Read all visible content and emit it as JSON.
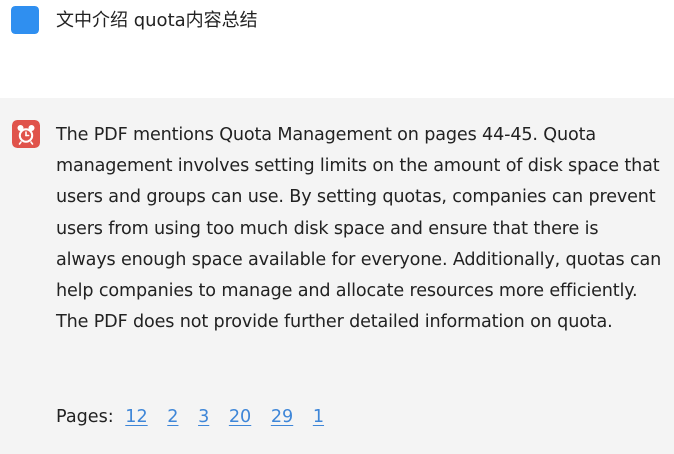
{
  "colors": {
    "user_avatar": "#2f8ff0",
    "bot_avatar": "#e0534b",
    "link": "#3e86d8",
    "bot_background": "#f4f4f4"
  },
  "user_message": {
    "avatar_icon": "blue-square-icon",
    "text": "文中介绍 quota内容总结"
  },
  "bot_message": {
    "avatar_icon": "alarm-clock-icon",
    "text": "The PDF mentions Quota Management on pages 44-45. Quota management involves setting limits on the amount of disk space that users and groups can use. By setting quotas, companies can prevent users from using too much disk space and ensure that there is always enough space available for everyone. Additionally, quotas can help companies to manage and allocate resources more efficiently. The PDF does not provide further detailed information on quota.",
    "pages_label": "Pages:",
    "pages": [
      "12",
      "2",
      "3",
      "20",
      "29",
      "1"
    ]
  }
}
